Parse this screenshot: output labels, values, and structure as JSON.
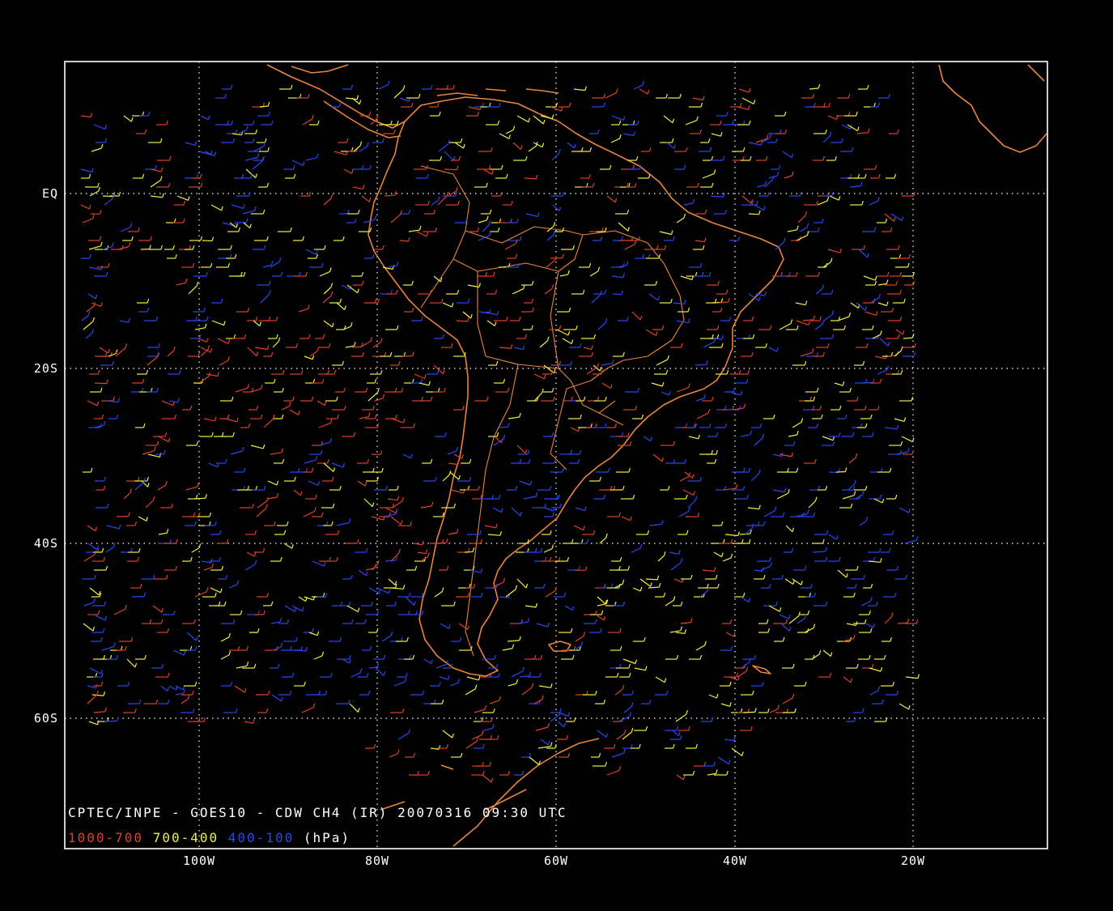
{
  "map": {
    "lat_labels": [
      "EQ",
      "20S",
      "40S",
      "60S"
    ],
    "lon_labels": [
      "100W",
      "80W",
      "60W",
      "40W",
      "20W"
    ],
    "caption": "CPTEC/INPE - GOES10 - CDW CH4 (IR) 20070316 09:30 UTC",
    "legend": {
      "low": "1000-700",
      "mid": "700-400",
      "high": "400-100",
      "unit": "(hPa)"
    },
    "colors": {
      "background": "#000000",
      "frame": "#ffffff",
      "grid": "#ffffff",
      "coastline": "#e8853a",
      "low_level": "#e0402a",
      "mid_level": "#f0f040",
      "high_level": "#2848f0"
    }
  }
}
